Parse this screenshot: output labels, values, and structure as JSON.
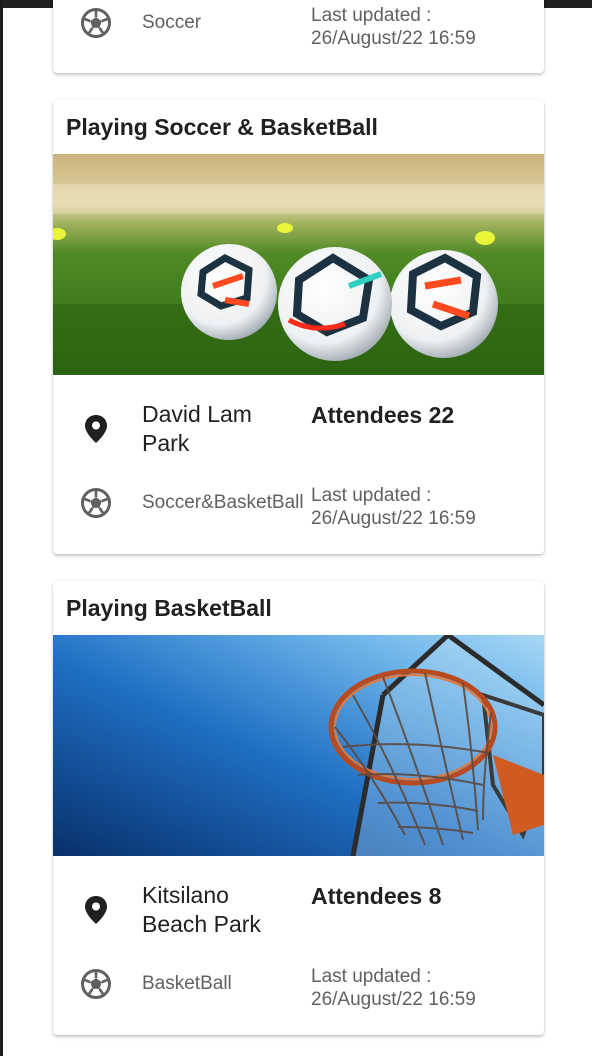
{
  "cards": [
    {
      "sport": "Soccer",
      "updated_label": "Last updated :",
      "updated_value": "26/August/22 16:59"
    },
    {
      "title": "Playing Soccer & BasketBall",
      "image": "soccer-balls-on-field",
      "location": "David Lam Park",
      "attendees": "Attendees 22",
      "sport": "Soccer&BasketBall",
      "updated_label": "Last updated :",
      "updated_value": "26/August/22 16:59"
    },
    {
      "title": "Playing BasketBall",
      "image": "basketball-hoop-sky",
      "location": "Kitsilano Beach Park",
      "attendees": "Attendees 8",
      "sport": "BasketBall",
      "updated_label": "Last updated :",
      "updated_value": "26/August/22 16:59"
    }
  ],
  "icons": {
    "location": "location-pin-icon",
    "sport": "soccer-ball-icon"
  }
}
